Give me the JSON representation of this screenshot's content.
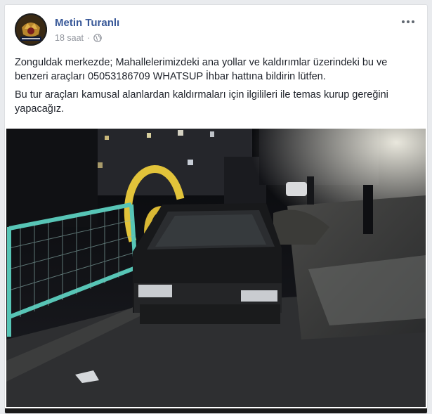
{
  "post": {
    "author": "Metin Turanlı",
    "time": "18 saat",
    "separator": "·",
    "privacy_icon": "globe-icon",
    "more_icon": "more-options-icon",
    "paragraphs": [
      "Zonguldak merkezde; Mahallelerimizdeki ana yollar ve kaldırımlar üzerindeki bu ve benzeri araçları 05053186709 WHATSUP İhbar hattına bildirin lütfen.",
      "Bu tur araçları kamusal alanlardan kaldırmaları için ilgilileri ile temas kurup gereğini yapacağız."
    ]
  },
  "colors": {
    "author_link": "#385898",
    "meta_gray": "#90949c",
    "text": "#1d2129",
    "background": "#e9ebee"
  }
}
